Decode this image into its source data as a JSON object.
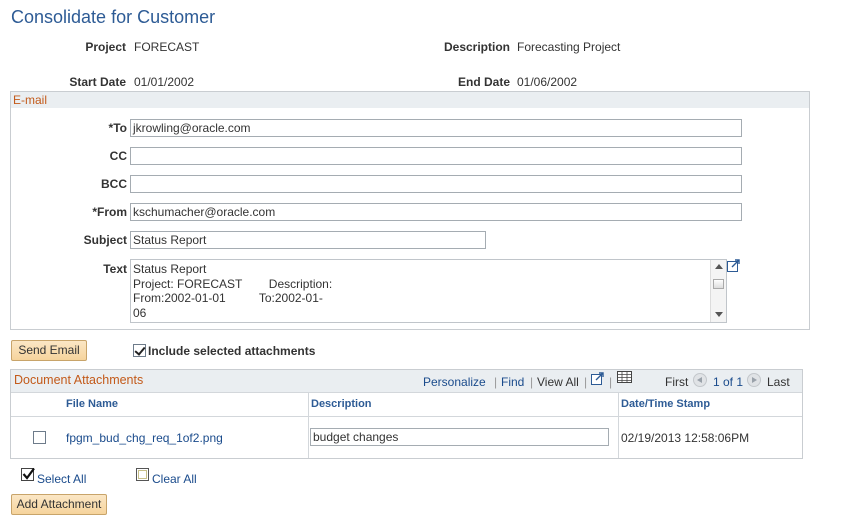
{
  "page": {
    "title": "Consolidate for Customer"
  },
  "summary": {
    "project_label": "Project",
    "project_value": "FORECAST",
    "description_label": "Description",
    "description_value": "Forecasting Project",
    "start_label": "Start Date",
    "start_value": "01/01/2002",
    "end_label": "End Date",
    "end_value": "01/06/2002"
  },
  "email": {
    "section_title": "E-mail",
    "to_label": "*To",
    "to_value": "jkrowling@oracle.com",
    "cc_label": "CC",
    "cc_value": "",
    "bcc_label": "BCC",
    "bcc_value": "",
    "from_label": "*From",
    "from_value": "kschumacher@oracle.com",
    "subject_label": "Subject",
    "subject_value": "Status Report",
    "text_label": "Text",
    "text_value": "Status Report\nProject: FORECAST        Description:\nFrom:2002-01-01          To:2002-01-\n06"
  },
  "actions": {
    "send_email": "Send Email",
    "include_attachments": "Include selected attachments",
    "include_checked": true
  },
  "attachments": {
    "section_title": "Document Attachments",
    "toolbar": {
      "personalize": "Personalize",
      "find": "Find",
      "view_all": "View All",
      "first": "First",
      "range": "1 of 1",
      "last": "Last"
    },
    "columns": [
      "File Name",
      "Description",
      "Date/Time Stamp"
    ],
    "rows": [
      {
        "selected": false,
        "file_name": "fpgm_bud_chg_req_1of2.png",
        "description": "budget changes",
        "timestamp": "02/19/2013 12:58:06PM"
      }
    ]
  },
  "footer": {
    "select_all": "Select All",
    "clear_all": "Clear All",
    "add_attachment": "Add Attachment"
  }
}
